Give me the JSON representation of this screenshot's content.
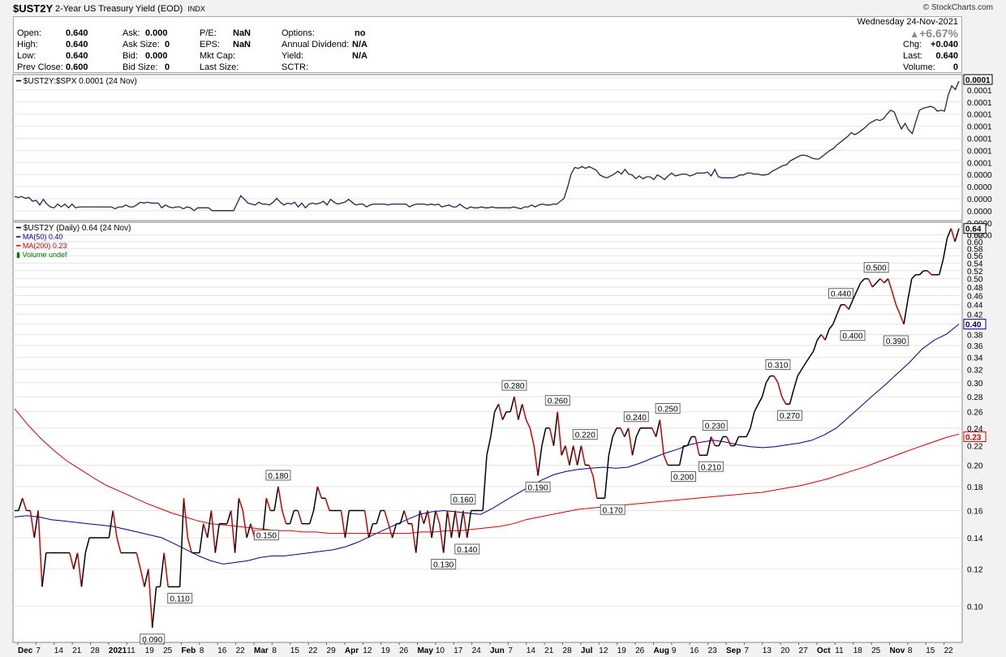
{
  "header": {
    "symbol": "$UST2Y",
    "name": "2-Year US Treasury Yield (EOD)",
    "exchange": "INDX",
    "logo": "© StockCharts.com",
    "date": "Wednesday  24-Nov-2021",
    "change_pct": "+6.67%",
    "stats": [
      {
        "label": "Open:",
        "value": "0.640"
      },
      {
        "label": "High:",
        "value": "0.640"
      },
      {
        "label": "Low:",
        "value": "0.640"
      },
      {
        "label": "Prev Close:",
        "value": "0.600"
      },
      {
        "label": "Ask:",
        "value": "0.000"
      },
      {
        "label": "Ask Size:",
        "value": "0"
      },
      {
        "label": "Bid:",
        "value": "0.000"
      },
      {
        "label": "Bid Size:",
        "value": "0"
      },
      {
        "label": "P/E:",
        "value": "NaN"
      },
      {
        "label": "EPS:",
        "value": "NaN"
      },
      {
        "label": "Mkt Cap:",
        "value": ""
      },
      {
        "label": "Last Size:",
        "value": ""
      },
      {
        "label": "Options:",
        "value": "no"
      },
      {
        "label": "Annual Dividend:",
        "value": "N/A"
      },
      {
        "label": "Yield:",
        "value": "N/A"
      },
      {
        "label": "SCTR:",
        "value": ""
      },
      {
        "label": "Chg:",
        "value": "+0.040"
      },
      {
        "label": "Last:",
        "value": "0.640"
      },
      {
        "label": "Volume:",
        "value": "0"
      }
    ]
  },
  "chart_data": [
    {
      "type": "line",
      "legend": "$UST2Y:$SPX 0.0001 (24 Nov)",
      "last_label": "0.0001",
      "y_tick_labels": [
        "0.0001",
        "0.0001",
        "0.0001",
        "0.0001",
        "0.0001",
        "0.0001",
        "0.0001",
        "0.0001",
        "0.0000",
        "0.0000",
        "0.0000",
        "0.0000",
        "0.0000",
        "0.0000"
      ],
      "values": [
        0.32,
        0.31,
        0.32,
        0.3,
        0.31,
        0.27,
        0.28,
        0.23,
        0.29,
        0.24,
        0.21,
        0.2,
        0.24,
        0.21,
        0.24,
        0.2,
        0.24,
        0.2,
        0.21,
        0.21,
        0.21,
        0.21,
        0.21,
        0.21,
        0.21,
        0.21,
        0.21,
        0.21,
        0.19,
        0.21,
        0.21,
        0.23,
        0.21,
        0.21,
        0.23,
        0.26,
        0.25,
        0.26,
        0.25,
        0.25,
        0.25,
        0.2,
        0.23,
        0.21,
        0.2,
        0.21,
        0.21,
        0.19,
        0.21,
        0.2,
        0.17,
        0.2,
        0.2,
        0.2,
        0.2,
        0.17,
        0.17,
        0.17,
        0.17,
        0.17,
        0.17,
        0.17,
        0.25,
        0.33,
        0.29,
        0.25,
        0.24,
        0.23,
        0.26,
        0.24,
        0.24,
        0.23,
        0.26,
        0.3,
        0.26,
        0.23,
        0.25,
        0.24,
        0.26,
        0.21,
        0.25,
        0.2,
        0.24,
        0.25,
        0.24,
        0.25,
        0.27,
        0.23,
        0.29,
        0.26,
        0.24,
        0.25,
        0.26,
        0.29,
        0.26,
        0.23,
        0.24,
        0.24,
        0.21,
        0.23,
        0.24,
        0.24,
        0.24,
        0.24,
        0.23,
        0.24,
        0.24,
        0.24,
        0.24,
        0.24,
        0.21,
        0.23,
        0.24,
        0.24,
        0.24,
        0.23,
        0.24,
        0.23,
        0.24,
        0.21,
        0.22,
        0.23,
        0.21,
        0.21,
        0.24,
        0.21,
        0.19,
        0.21,
        0.2,
        0.2,
        0.21,
        0.2,
        0.2,
        0.21,
        0.2,
        0.2,
        0.2,
        0.2,
        0.2,
        0.21,
        0.2,
        0.19,
        0.21,
        0.21,
        0.23,
        0.21,
        0.23,
        0.24,
        0.23,
        0.23,
        0.24,
        0.24,
        0.27,
        0.3,
        0.42,
        0.56,
        0.63,
        0.62,
        0.64,
        0.62,
        0.64,
        0.62,
        0.6,
        0.55,
        0.53,
        0.52,
        0.54,
        0.56,
        0.59,
        0.56,
        0.61,
        0.56,
        0.55,
        0.51,
        0.54,
        0.51,
        0.53,
        0.53,
        0.5,
        0.55,
        0.53,
        0.5,
        0.54,
        0.57,
        0.54,
        0.55,
        0.56,
        0.56,
        0.54,
        0.55,
        0.57,
        0.57,
        0.57,
        0.58,
        0.54,
        0.61,
        0.53,
        0.52,
        0.52,
        0.52,
        0.52,
        0.53,
        0.55,
        0.55,
        0.57,
        0.57,
        0.56,
        0.56,
        0.55,
        0.55,
        0.56,
        0.59,
        0.61,
        0.63,
        0.65,
        0.66,
        0.7,
        0.72,
        0.74,
        0.76,
        0.76,
        0.75,
        0.73,
        0.72,
        0.72,
        0.75,
        0.78,
        0.81,
        0.83,
        0.87,
        0.9,
        0.93,
        0.96,
        1.0,
        0.98,
        1.0,
        1.03,
        1.06,
        1.1,
        1.12,
        1.14,
        1.13,
        1.15,
        1.2,
        1.24,
        1.22,
        1.12,
        1.04,
        1.1,
        1.03,
        0.99,
        1.12,
        1.24,
        1.26,
        1.27,
        1.28,
        1.27,
        1.23,
        1.24,
        1.23,
        1.4,
        1.5,
        1.46,
        1.55
      ]
    },
    {
      "type": "line",
      "legend": [
        {
          "name": "$UST2Y (Daily) 0.64 (24 Nov)",
          "color": "#000000"
        },
        {
          "name": "MA(50) 0.40",
          "color": "#00008b"
        },
        {
          "name": "MA(200) 0.23",
          "color": "#cc0000"
        },
        {
          "name": "Volume undef",
          "color": "#007700"
        }
      ],
      "ylim": [
        0.0837,
        0.66
      ],
      "yscale": "log",
      "y_ticks": [
        0.1,
        0.12,
        0.14,
        0.16,
        0.18,
        0.2,
        0.22,
        0.24,
        0.26,
        0.28,
        0.3,
        0.32,
        0.34,
        0.36,
        0.38,
        0.4,
        0.42,
        0.44,
        0.46,
        0.48,
        0.5,
        0.52,
        0.54,
        0.56,
        0.58,
        0.6,
        0.62
      ],
      "right_labels": [
        {
          "value": 0.64,
          "text": "0.64",
          "color": "#000000"
        },
        {
          "value": 0.4,
          "text": "0.40",
          "color": "#00008b"
        },
        {
          "value": 0.23,
          "text": "0.23",
          "color": "#cc0000"
        }
      ],
      "x_labels": [
        "Dec",
        "7",
        "14",
        "21",
        "28",
        "2021",
        "11",
        "19",
        "25",
        "Feb",
        "8",
        "16",
        "22",
        "Mar",
        "8",
        "15",
        "22",
        "29",
        "Apr",
        "12",
        "19",
        "26",
        "May",
        "10",
        "17",
        "24",
        "Jun",
        "7",
        "14",
        "21",
        "28",
        "Jul",
        "12",
        "19",
        "26",
        "Aug",
        "9",
        "16",
        "23",
        "Sep",
        "7",
        "13",
        "20",
        "27",
        "Oct",
        "11",
        "18",
        "25",
        "Nov",
        "8",
        "15",
        "22"
      ],
      "series": [
        {
          "name": "$UST2Y",
          "values": [
            0.16,
            0.16,
            0.17,
            0.16,
            0.16,
            0.14,
            0.16,
            0.11,
            0.13,
            0.13,
            0.13,
            0.13,
            0.13,
            0.13,
            0.13,
            0.12,
            0.13,
            0.11,
            0.13,
            0.14,
            0.14,
            0.14,
            0.14,
            0.14,
            0.14,
            0.16,
            0.14,
            0.13,
            0.13,
            0.13,
            0.13,
            0.13,
            0.12,
            0.11,
            0.12,
            0.09,
            0.11,
            0.11,
            0.13,
            0.11,
            0.11,
            0.11,
            0.11,
            0.17,
            0.14,
            0.13,
            0.13,
            0.13,
            0.15,
            0.14,
            0.16,
            0.13,
            0.15,
            0.15,
            0.15,
            0.16,
            0.13,
            0.17,
            0.16,
            0.14,
            0.15,
            0.14,
            0.14,
            0.14,
            0.17,
            0.16,
            0.16,
            0.18,
            0.16,
            0.15,
            0.15,
            0.16,
            0.16,
            0.15,
            0.15,
            0.15,
            0.16,
            0.18,
            0.17,
            0.17,
            0.16,
            0.16,
            0.16,
            0.16,
            0.14,
            0.16,
            0.16,
            0.16,
            0.16,
            0.16,
            0.14,
            0.15,
            0.15,
            0.16,
            0.16,
            0.15,
            0.14,
            0.15,
            0.15,
            0.16,
            0.15,
            0.15,
            0.13,
            0.16,
            0.15,
            0.16,
            0.14,
            0.16,
            0.15,
            0.13,
            0.16,
            0.14,
            0.16,
            0.14,
            0.16,
            0.14,
            0.16,
            0.16,
            0.16,
            0.16,
            0.21,
            0.23,
            0.26,
            0.27,
            0.25,
            0.26,
            0.26,
            0.28,
            0.25,
            0.27,
            0.25,
            0.24,
            0.22,
            0.19,
            0.22,
            0.24,
            0.24,
            0.22,
            0.26,
            0.21,
            0.22,
            0.2,
            0.22,
            0.2,
            0.22,
            0.2,
            0.2,
            0.19,
            0.17,
            0.17,
            0.17,
            0.21,
            0.23,
            0.24,
            0.24,
            0.23,
            0.24,
            0.21,
            0.23,
            0.24,
            0.24,
            0.24,
            0.24,
            0.23,
            0.25,
            0.21,
            0.2,
            0.2,
            0.2,
            0.2,
            0.22,
            0.22,
            0.23,
            0.23,
            0.21,
            0.21,
            0.21,
            0.23,
            0.22,
            0.22,
            0.23,
            0.23,
            0.22,
            0.22,
            0.23,
            0.23,
            0.23,
            0.24,
            0.26,
            0.27,
            0.28,
            0.3,
            0.31,
            0.31,
            0.3,
            0.28,
            0.27,
            0.27,
            0.29,
            0.31,
            0.32,
            0.33,
            0.34,
            0.35,
            0.37,
            0.38,
            0.37,
            0.39,
            0.4,
            0.42,
            0.44,
            0.44,
            0.43,
            0.45,
            0.47,
            0.49,
            0.5,
            0.5,
            0.48,
            0.49,
            0.5,
            0.49,
            0.5,
            0.47,
            0.44,
            0.42,
            0.4,
            0.45,
            0.5,
            0.51,
            0.51,
            0.52,
            0.52,
            0.51,
            0.51,
            0.51,
            0.55,
            0.61,
            0.64,
            0.6,
            0.64
          ]
        },
        {
          "name": "MA(50)",
          "values": [
            0.155,
            0.156,
            0.155,
            0.153,
            0.152,
            0.151,
            0.15,
            0.149,
            0.148,
            0.146,
            0.144,
            0.142,
            0.14,
            0.136,
            0.132,
            0.128,
            0.125,
            0.123,
            0.124,
            0.125,
            0.127,
            0.128,
            0.128,
            0.129,
            0.13,
            0.131,
            0.132,
            0.134,
            0.137,
            0.141,
            0.145,
            0.149,
            0.153,
            0.157,
            0.159,
            0.16,
            0.159,
            0.158,
            0.157,
            0.162,
            0.168,
            0.174,
            0.18,
            0.186,
            0.191,
            0.194,
            0.196,
            0.197,
            0.198,
            0.197,
            0.198,
            0.202,
            0.207,
            0.212,
            0.216,
            0.221,
            0.224,
            0.226,
            0.224,
            0.221,
            0.219,
            0.218,
            0.219,
            0.221,
            0.223,
            0.226,
            0.232,
            0.24,
            0.253,
            0.267,
            0.282,
            0.297,
            0.314,
            0.332,
            0.354,
            0.37,
            0.381,
            0.4
          ]
        },
        {
          "name": "MA(200)",
          "values": [
            0.264,
            0.244,
            0.228,
            0.215,
            0.204,
            0.196,
            0.188,
            0.181,
            0.176,
            0.171,
            0.166,
            0.162,
            0.158,
            0.155,
            0.152,
            0.15,
            0.149,
            0.148,
            0.147,
            0.146,
            0.145,
            0.145,
            0.144,
            0.144,
            0.143,
            0.143,
            0.143,
            0.143,
            0.143,
            0.143,
            0.143,
            0.144,
            0.144,
            0.145,
            0.145,
            0.146,
            0.147,
            0.148,
            0.15,
            0.153,
            0.155,
            0.157,
            0.159,
            0.161,
            0.162,
            0.163,
            0.164,
            0.165,
            0.166,
            0.167,
            0.168,
            0.169,
            0.17,
            0.171,
            0.172,
            0.173,
            0.174,
            0.175,
            0.177,
            0.179,
            0.181,
            0.184,
            0.187,
            0.191,
            0.195,
            0.199,
            0.204,
            0.209,
            0.214,
            0.219,
            0.224,
            0.229,
            0.233
          ]
        }
      ],
      "annotations": [
        {
          "text": "0.090",
          "x": 35,
          "y": 0.09,
          "pos": "below"
        },
        {
          "text": "0.110",
          "x": 42,
          "y": 0.11,
          "pos": "below"
        },
        {
          "text": "0.180",
          "x": 67,
          "y": 0.18,
          "pos": "above"
        },
        {
          "text": "0.150",
          "x": 64,
          "y": 0.15,
          "pos": "below"
        },
        {
          "text": "0.160",
          "x": 114,
          "y": 0.16,
          "pos": "above"
        },
        {
          "text": "0.130",
          "x": 109,
          "y": 0.13,
          "pos": "below"
        },
        {
          "text": "0.140",
          "x": 115,
          "y": 0.14,
          "pos": "below"
        },
        {
          "text": "0.280",
          "x": 127,
          "y": 0.28,
          "pos": "above"
        },
        {
          "text": "0.190",
          "x": 133,
          "y": 0.19,
          "pos": "below"
        },
        {
          "text": "0.260",
          "x": 138,
          "y": 0.26,
          "pos": "above"
        },
        {
          "text": "0.220",
          "x": 145,
          "y": 0.22,
          "pos": "above"
        },
        {
          "text": "0.170",
          "x": 152,
          "y": 0.17,
          "pos": "below"
        },
        {
          "text": "0.240",
          "x": 158,
          "y": 0.24,
          "pos": "above"
        },
        {
          "text": "0.250",
          "x": 166,
          "y": 0.25,
          "pos": "above"
        },
        {
          "text": "0.200",
          "x": 170,
          "y": 0.2,
          "pos": "below"
        },
        {
          "text": "0.230",
          "x": 178,
          "y": 0.23,
          "pos": "above"
        },
        {
          "text": "0.210",
          "x": 177,
          "y": 0.21,
          "pos": "below"
        },
        {
          "text": "0.310",
          "x": 194,
          "y": 0.31,
          "pos": "above"
        },
        {
          "text": "0.270",
          "x": 197,
          "y": 0.27,
          "pos": "below"
        },
        {
          "text": "0.440",
          "x": 210,
          "y": 0.44,
          "pos": "above"
        },
        {
          "text": "0.400",
          "x": 213,
          "y": 0.4,
          "pos": "below"
        },
        {
          "text": "0.500",
          "x": 219,
          "y": 0.5,
          "pos": "above"
        },
        {
          "text": "0.390",
          "x": 224,
          "y": 0.39,
          "pos": "below"
        }
      ]
    }
  ]
}
